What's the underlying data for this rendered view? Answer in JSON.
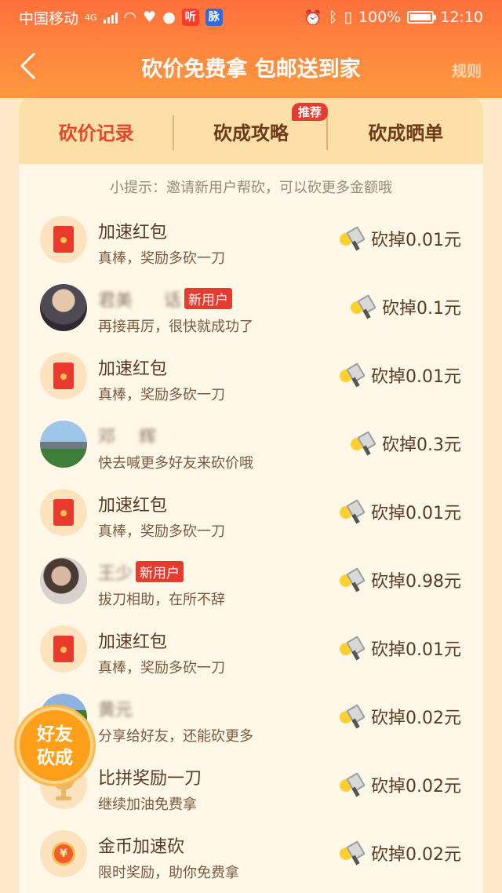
{
  "status_bar": {
    "carrier": "中国移动",
    "network": "4G",
    "battery": "100%",
    "time": "12:10",
    "app_badge_1": "听",
    "app_badge_2": "脉"
  },
  "header": {
    "title": "砍价免费拿 包邮送到家",
    "rules_label": "规则"
  },
  "tabs": [
    {
      "label": "砍价记录"
    },
    {
      "label": "砍成攻略"
    },
    {
      "label": "砍成晒单"
    }
  ],
  "tab_badge": "推荐",
  "tip": "小提示：邀请新用户帮砍，可以砍更多金额哦",
  "records": [
    {
      "name": "加速红包",
      "sub": "真棒，奖励多砍一刀",
      "amount": "砍掉0.01元",
      "avatar": "red-packet-icon"
    },
    {
      "name": "君美",
      "name_end": "话",
      "tag": "新用户",
      "sub": "再接再厉，很快就成功了",
      "amount": "砍掉0.1元",
      "avatar": "user-photo"
    },
    {
      "name": "加速红包",
      "sub": "真棒，奖励多砍一刀",
      "amount": "砍掉0.01元",
      "avatar": "red-packet-icon"
    },
    {
      "name": "邓",
      "name_end": "辉",
      "sub": "快去喊更多好友来砍价哦",
      "amount": "砍掉0.3元",
      "avatar": "user-photo"
    },
    {
      "name": "加速红包",
      "sub": "真棒，奖励多砍一刀",
      "amount": "砍掉0.01元",
      "avatar": "red-packet-icon"
    },
    {
      "name": "王少",
      "tag": "新用户",
      "sub": "拔刀相助，在所不辞",
      "amount": "砍掉0.98元",
      "avatar": "user-photo"
    },
    {
      "name": "加速红包",
      "sub": "真棒，奖励多砍一刀",
      "amount": "砍掉0.01元",
      "avatar": "red-packet-icon"
    },
    {
      "name": "黄元",
      "sub": "分享给好友，还能砍更多",
      "amount": "砍掉0.02元",
      "avatar": "user-photo"
    },
    {
      "name": "比拼奖励一刀",
      "sub": "继续加油免费拿",
      "amount": "砍掉0.02元",
      "avatar": "pk-trophy-icon"
    },
    {
      "name": "金币加速砍",
      "sub": "限时奖励，助你免费拿",
      "amount": "砍掉0.02元",
      "avatar": "gold-coin-icon"
    }
  ],
  "float_button": {
    "line1": "好友",
    "line2": "砍成"
  }
}
